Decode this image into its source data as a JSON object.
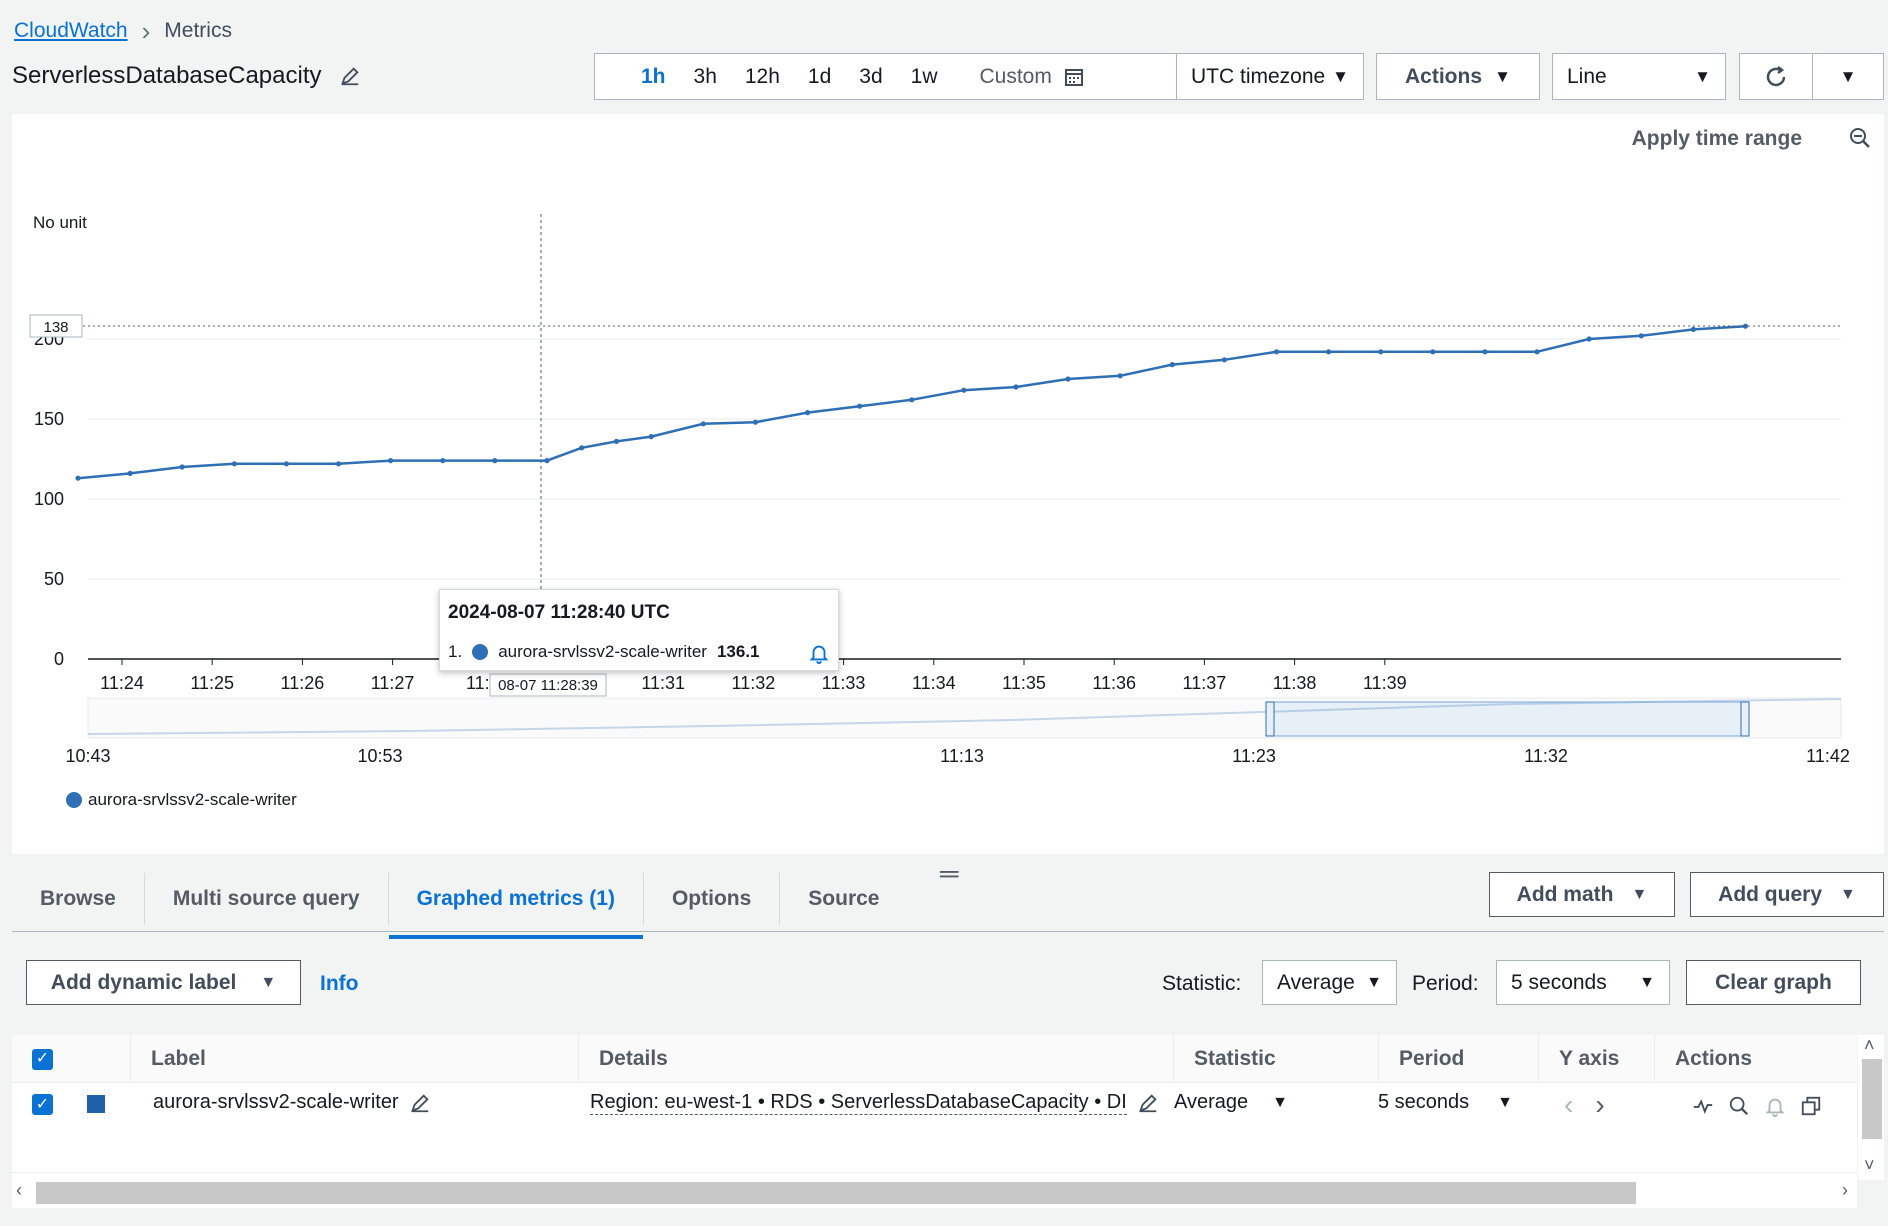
{
  "breadcrumb": {
    "root": "CloudWatch",
    "current": "Metrics"
  },
  "title": "ServerlessDatabaseCapacity",
  "time_ranges": [
    "1h",
    "3h",
    "12h",
    "1d",
    "3d",
    "1w"
  ],
  "time_range_active": "1h",
  "custom_label": "Custom",
  "timezone": "UTC timezone",
  "actions_label": "Actions",
  "view_type": "Line",
  "apply_time_range": "Apply time range",
  "legend_series": "aurora-srvlssv2-scale-writer",
  "tooltip": {
    "time": "2024-08-07 11:28:40 UTC",
    "index": "1.",
    "series": "aurora-srvlssv2-scale-writer",
    "value": "136.1"
  },
  "crosshair_label": "08-07 11:28:39",
  "crosshair_y_label": "138",
  "chart_data": {
    "type": "line",
    "ylabel": "No unit",
    "y_ticks": [
      "200",
      "150",
      "100",
      "50",
      "0"
    ],
    "ylim": [
      0,
      200
    ],
    "x_ticks": [
      "11:24",
      "11:25",
      "11:26",
      "11:27",
      "11:2",
      "11:30",
      "11:31",
      "11:32",
      "11:33",
      "11:34",
      "11:35",
      "11:36",
      "11:37",
      "11:38",
      "11:39"
    ],
    "overview_ticks": [
      "10:43",
      "10:53",
      "11:13",
      "11:23",
      "11:32",
      "11:42"
    ],
    "series": [
      {
        "name": "aurora-srvlssv2-scale-writer",
        "x": [
          "11:23:30",
          "11:24:00",
          "11:24:30",
          "11:25:00",
          "11:25:30",
          "11:26:00",
          "11:26:30",
          "11:27:00",
          "11:27:30",
          "11:28:00",
          "11:28:20",
          "11:28:40",
          "11:29:00",
          "11:29:30",
          "11:30:00",
          "11:30:30",
          "11:31:00",
          "11:31:30",
          "11:32:00",
          "11:32:30",
          "11:33:00",
          "11:33:30",
          "11:34:00",
          "11:34:30",
          "11:35:00",
          "11:35:30",
          "11:36:00",
          "11:36:30",
          "11:37:00",
          "11:37:30",
          "11:38:00",
          "11:38:30",
          "11:39:00",
          "11:39:30"
        ],
        "values": [
          113,
          116,
          120,
          122,
          122,
          122,
          124,
          124,
          124,
          124,
          132,
          136,
          139,
          147,
          148,
          154,
          158,
          162,
          168,
          170,
          175,
          177,
          184,
          187,
          192,
          192,
          192,
          192,
          192,
          192,
          200,
          202,
          206,
          208
        ]
      }
    ]
  },
  "tabs": [
    "Browse",
    "Multi source query",
    "Graphed metrics (1)",
    "Options",
    "Source"
  ],
  "tab_active": "Graphed metrics (1)",
  "add_math": "Add math",
  "add_query": "Add query",
  "add_dynamic_label": "Add dynamic label",
  "info": "Info",
  "statistic_label": "Statistic:",
  "statistic_value": "Average",
  "period_label": "Period:",
  "period_value": "5 seconds",
  "clear_graph": "Clear graph",
  "table": {
    "headers": [
      "Label",
      "Details",
      "Statistic",
      "Period",
      "Y axis",
      "Actions"
    ],
    "rows": [
      {
        "label": "aurora-srvlssv2-scale-writer",
        "details": "Region: eu-west-1 • RDS • ServerlessDatabaseCapacity • DI",
        "statistic": "Average",
        "period": "5 seconds"
      }
    ]
  }
}
